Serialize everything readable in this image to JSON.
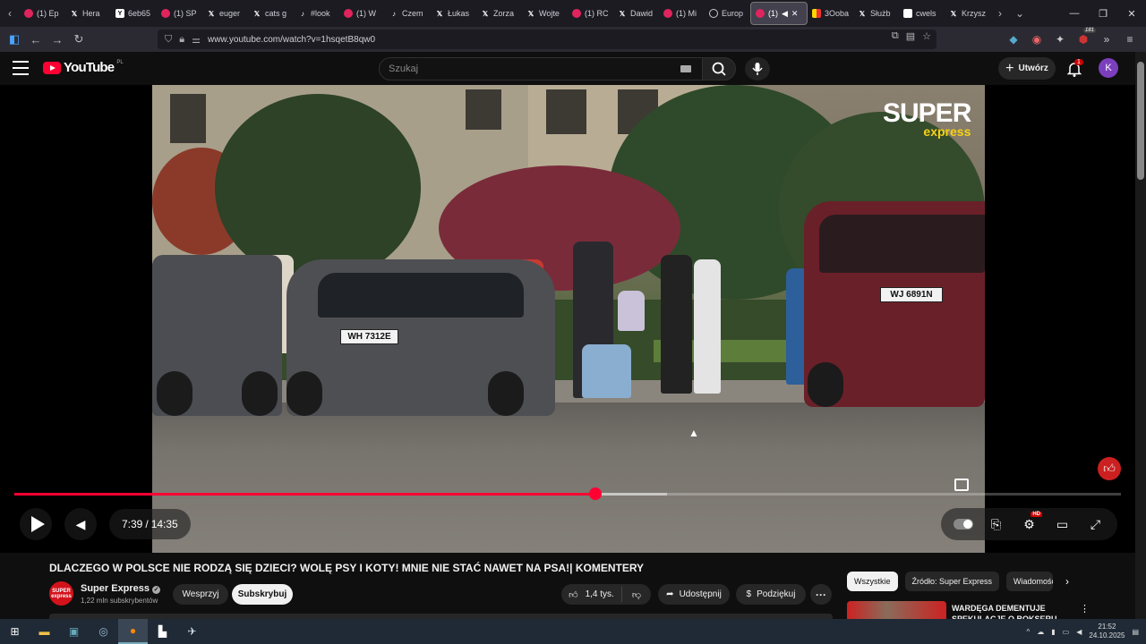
{
  "browser": {
    "tabs": [
      {
        "icon": "yt",
        "label": "(1) Ep"
      },
      {
        "icon": "x",
        "label": "Hera"
      },
      {
        "icon": "yb",
        "label": "6eb65"
      },
      {
        "icon": "yt",
        "label": "(1) SP"
      },
      {
        "icon": "x",
        "label": "euger"
      },
      {
        "icon": "x",
        "label": "cats g"
      },
      {
        "icon": "tk",
        "label": "#look"
      },
      {
        "icon": "yt",
        "label": "(1) W"
      },
      {
        "icon": "tk",
        "label": "Czem"
      },
      {
        "icon": "x",
        "label": "Łukas"
      },
      {
        "icon": "x",
        "label": "Zorza"
      },
      {
        "icon": "x",
        "label": "Wojte"
      },
      {
        "icon": "yt",
        "label": "(1) RC"
      },
      {
        "icon": "x",
        "label": "Dawid"
      },
      {
        "icon": "yt",
        "label": "(1) Mi"
      },
      {
        "icon": "gl",
        "label": "Europ"
      },
      {
        "icon": "yt",
        "label": "(1)",
        "active": true
      },
      {
        "icon": "dc",
        "label": "3Ooba"
      },
      {
        "icon": "x",
        "label": "Służb"
      },
      {
        "icon": "gt",
        "label": "cwels"
      },
      {
        "icon": "x",
        "label": "Krzysz"
      }
    ],
    "url": "www.youtube.com/watch?v=1hsqetB8qw0",
    "extensions_badge": "181"
  },
  "youtube": {
    "logo_text": "YouTube",
    "region": "PL",
    "search_placeholder": "Szukaj",
    "create_label": "Utwórz",
    "notification_count": "1",
    "avatar_letter": "K"
  },
  "video": {
    "overlay_logo_top": "SUPER",
    "overlay_logo_bottom": "express",
    "plate_left": "WH 7312E",
    "plate_right": "WJ 6891N",
    "time_current": "7:39",
    "time_total": "14:35",
    "progress_fraction": 0.525,
    "buffered_fraction": 0.59,
    "hd_badge": "HD",
    "title": "DLACZEGO W POLSCE NIE RODZĄ SIĘ DZIECI? WOLĘ PSY I KOTY! MNIE NIE STAĆ NAWET NA PSA!| KOMENTERY"
  },
  "channel": {
    "name": "Super Express",
    "avatar_text": "SUPER express",
    "subscribers": "1,22 mln subskrybentów",
    "support_label": "Wesprzyj",
    "subscribe_label": "Subskrybuj"
  },
  "actions": {
    "likes": "1,4 tys.",
    "share_label": "Udostępnij",
    "thanks_label": "Podziękuj"
  },
  "sidebar": {
    "chips": [
      "Wszystkie",
      "Źródło: Super Express",
      "Wiadomości"
    ],
    "first_rec_title": "WARDĘGA DEMENTUJE SPEKULACJE O BOKSERU"
  },
  "taskbar": {
    "time": "21:52",
    "date": "24.10.2025"
  }
}
